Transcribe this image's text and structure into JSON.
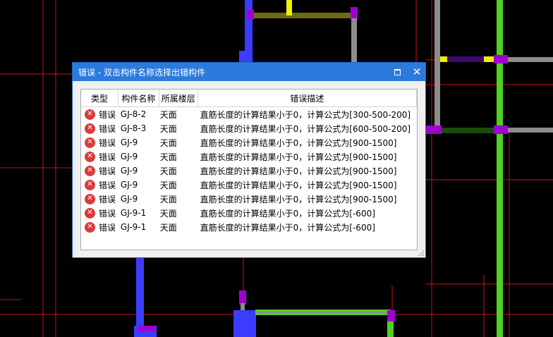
{
  "dialog": {
    "title": "错误 - 双击构件名称选择出错构件",
    "maximize_icon": "maximize-icon",
    "close_icon": "close-icon",
    "close_glyph": "✕"
  },
  "table": {
    "columns": [
      "类型",
      "构件名称",
      "所属楼层",
      "错误描述"
    ],
    "error_icon": "error-circle-icon",
    "error_glyph": "✕",
    "rows": [
      {
        "type": "错误",
        "name": "GJ-8-2",
        "floor": "天面",
        "desc": "直筋长度的计算结果小于0，计算公式为[300-500-200]"
      },
      {
        "type": "错误",
        "name": "GJ-8-3",
        "floor": "天面",
        "desc": "直筋长度的计算结果小于0，计算公式为[600-500-200]"
      },
      {
        "type": "错误",
        "name": "GJ-9",
        "floor": "天面",
        "desc": "直筋长度的计算结果小于0，计算公式为[900-1500]"
      },
      {
        "type": "错误",
        "name": "GJ-9",
        "floor": "天面",
        "desc": "直筋长度的计算结果小于0，计算公式为[900-1500]"
      },
      {
        "type": "错误",
        "name": "GJ-9",
        "floor": "天面",
        "desc": "直筋长度的计算结果小于0，计算公式为[900-1500]"
      },
      {
        "type": "错误",
        "name": "GJ-9",
        "floor": "天面",
        "desc": "直筋长度的计算结果小于0，计算公式为[900-1500]"
      },
      {
        "type": "错误",
        "name": "GJ-9",
        "floor": "天面",
        "desc": "直筋长度的计算结果小于0，计算公式为[900-1500]"
      },
      {
        "type": "错误",
        "name": "GJ-9-1",
        "floor": "天面",
        "desc": "直筋长度的计算结果小于0，计算公式为[-600]"
      },
      {
        "type": "错误",
        "name": "GJ-9-1",
        "floor": "天面",
        "desc": "直筋长度的计算结果小于0，计算公式为[-600]"
      }
    ]
  },
  "colors": {
    "background": "#000000",
    "axis_line": "#c8141e",
    "titlebar": "#2b7bdc",
    "error_icon": "#dd3a3a",
    "member_blue": "#3c3cff",
    "member_green": "#50d020",
    "member_magenta": "#a000d0",
    "member_yellow": "#f0f000"
  }
}
